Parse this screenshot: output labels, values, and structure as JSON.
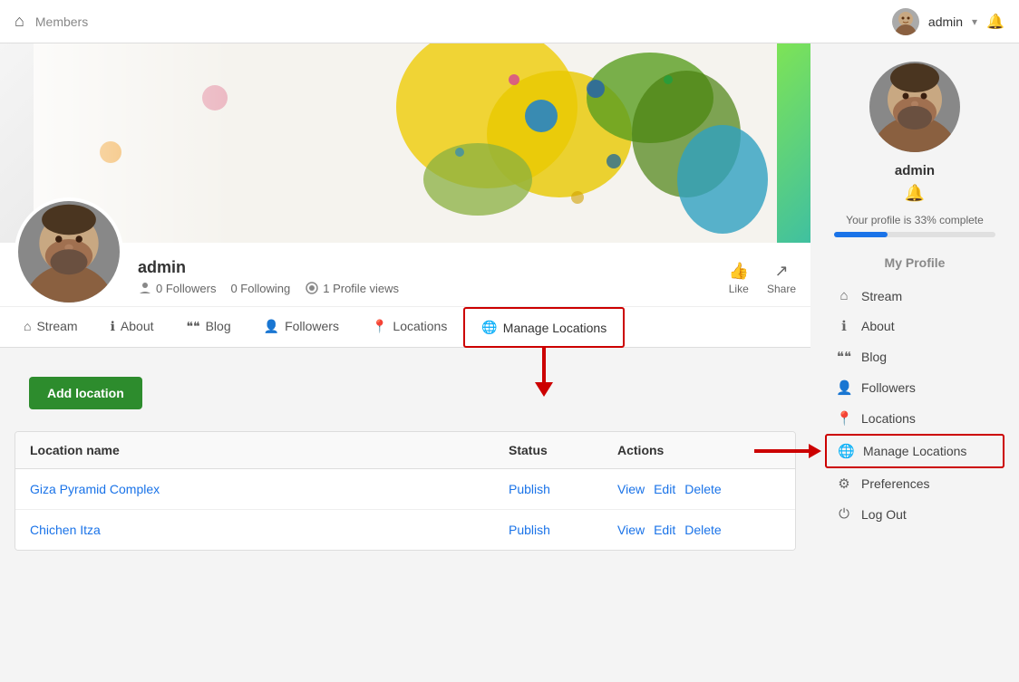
{
  "topnav": {
    "members_label": "Members",
    "admin_label": "admin",
    "home_icon": "⌂",
    "bell_icon": "🔔",
    "chevron": "▾"
  },
  "profile": {
    "name": "admin",
    "followers": "0 Followers",
    "following": "0 Following",
    "profile_views": "1 Profile views",
    "like_label": "Like",
    "share_label": "Share"
  },
  "tabs": [
    {
      "id": "stream",
      "label": "Stream",
      "icon": "⌂"
    },
    {
      "id": "about",
      "label": "About",
      "icon": "ℹ"
    },
    {
      "id": "blog",
      "label": "Blog",
      "icon": "❝❝"
    },
    {
      "id": "followers",
      "label": "Followers",
      "icon": "👤"
    },
    {
      "id": "locations",
      "label": "Locations",
      "icon": "📍"
    },
    {
      "id": "manage-locations",
      "label": "Manage Locations",
      "icon": "🌐"
    }
  ],
  "add_location_label": "Add location",
  "table": {
    "headers": [
      "Location name",
      "Status",
      "Actions"
    ],
    "rows": [
      {
        "name": "Giza Pyramid Complex",
        "status": "Publish",
        "actions": [
          "View",
          "Edit",
          "Delete"
        ]
      },
      {
        "name": "Chichen Itza",
        "status": "Publish",
        "actions": [
          "View",
          "Edit",
          "Delete"
        ]
      }
    ]
  },
  "sidebar": {
    "name": "admin",
    "progress_text": "Your profile is 33% complete",
    "my_profile_label": "My Profile",
    "nav_items": [
      {
        "id": "stream",
        "label": "Stream",
        "icon": "⌂"
      },
      {
        "id": "about",
        "label": "About",
        "icon": "ℹ"
      },
      {
        "id": "blog",
        "label": "Blog",
        "icon": "❝❝"
      },
      {
        "id": "followers",
        "label": "Followers",
        "icon": "👤"
      },
      {
        "id": "locations",
        "label": "Locations",
        "icon": "📍"
      },
      {
        "id": "manage-locations",
        "label": "Manage Locations",
        "icon": "🌐"
      },
      {
        "id": "preferences",
        "label": "Preferences",
        "icon": "⚙"
      },
      {
        "id": "logout",
        "label": "Log Out",
        "icon": "⏻"
      }
    ]
  }
}
